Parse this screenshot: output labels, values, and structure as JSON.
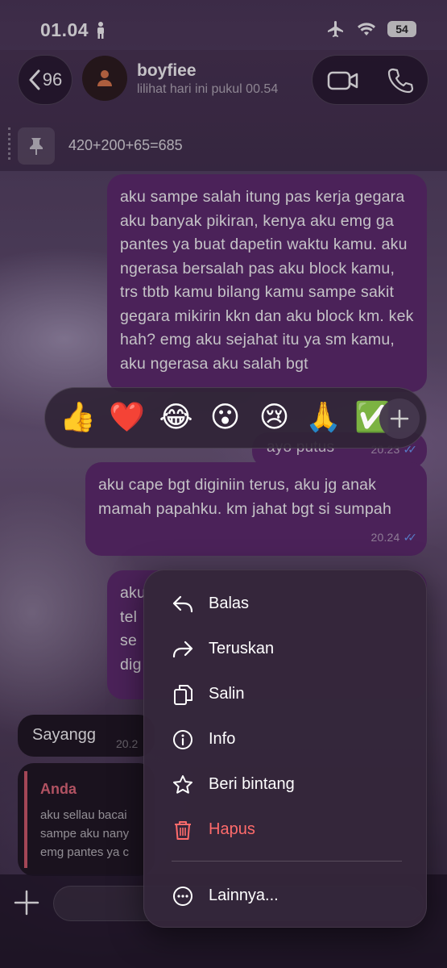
{
  "status_bar": {
    "time": "01.04",
    "battery": "54"
  },
  "header": {
    "back_count": "96",
    "contact_name": "boyfiee",
    "contact_status": "lilihat hari ini pukul 00.54",
    "pinned_text": "420+200+65=685"
  },
  "messages": {
    "m1_text": "aku sampe salah itung pas kerja gegara aku banyak pikiran, kenya aku emg ga pantes ya buat dapetin waktu kamu. aku ngerasa bersalah pas aku block kamu, trs tbtb kamu bilang kamu sampe sakit gegara mikirin kkn dan aku block km. kek hah? emg aku sejahat itu ya sm kamu, aku ngerasa aku salah bgt",
    "m2_text": "ayo putus",
    "m2_time": "20.23",
    "m3_text": "aku cape bgt diginiin terus, aku jg anak mamah papahku. km jahat bgt si sumpah",
    "m3_time": "20.24",
    "m4_text": "aku tel se dig",
    "incoming_1_text": "Sayangg",
    "incoming_1_time": "20.2",
    "reply_author": "Anda",
    "reply_line_1": "aku sellau bacai",
    "reply_line_2": "sampe aku nany",
    "reply_line_3": "emg pantes ya c"
  },
  "reactions": [
    "👍",
    "❤️",
    "😂",
    "😮",
    "😢",
    "🙏",
    "✅"
  ],
  "menu": {
    "reply": "Balas",
    "forward": "Teruskan",
    "copy": "Salin",
    "info": "Info",
    "star": "Beri bintang",
    "delete": "Hapus",
    "more": "Lainnya..."
  },
  "colors": {
    "outgoing_bubble": "#5e2a6e",
    "incoming_bubble": "#1d151f",
    "read_ticks": "#6ea0ff",
    "danger": "#ff6b6b",
    "reply_accent": "#e66a7a"
  }
}
